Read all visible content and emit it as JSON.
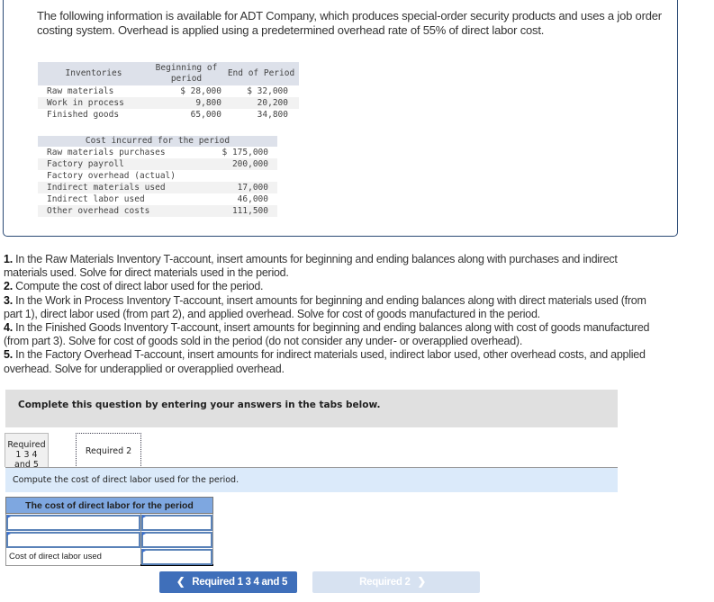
{
  "intro": "The following information is available for ADT Company, which produces special-order security products and uses a job order costing system. Overhead is applied using a predetermined overhead rate of 55% of direct labor cost.",
  "inventories": {
    "headers": [
      "Inventories",
      "Beginning of period",
      "End of Period"
    ],
    "rows": [
      {
        "label": "Raw materials",
        "beginning": "$ 28,000",
        "end": "$ 32,000"
      },
      {
        "label": "Work in process",
        "beginning": "9,800",
        "end": "20,200"
      },
      {
        "label": "Finished goods",
        "beginning": "65,000",
        "end": "34,800"
      }
    ]
  },
  "costs": {
    "header": "Cost incurred for the period",
    "rows": [
      {
        "label": "Raw materials purchases",
        "value": "$ 175,000"
      },
      {
        "label": "Factory payroll",
        "value": "200,000"
      },
      {
        "label": "Factory overhead (actual)",
        "value": ""
      },
      {
        "label": "Indirect materials used",
        "value": "17,000"
      },
      {
        "label": "Indirect labor used",
        "value": "46,000"
      },
      {
        "label": "Other overhead costs",
        "value": "111,500"
      }
    ]
  },
  "requirements": [
    {
      "num": "1.",
      "text": " In the Raw Materials Inventory T-account, insert amounts for beginning and ending balances along with purchases and indirect materials used. Solve for direct materials used in the period."
    },
    {
      "num": "2.",
      "text": " Compute the cost of direct labor used for the period."
    },
    {
      "num": "3.",
      "text": " In the Work in Process Inventory T-account, insert amounts for beginning and ending balances along with direct materials used (from part 1), direct labor used (from part 2), and applied overhead. Solve for cost of goods manufactured in the period."
    },
    {
      "num": "4.",
      "text": " In the Finished Goods Inventory T-account, insert amounts for beginning and ending balances along with cost of goods manufactured (from part 3). Solve for cost of goods sold in the period (do not consider any under- or overapplied overhead)."
    },
    {
      "num": "5.",
      "text": " In the Factory Overhead T-account, insert amounts for indirect materials used, indirect labor used, other overhead costs, and applied overhead. Solve for underapplied or overapplied overhead."
    }
  ],
  "complete_prompt": "Complete this question by entering your answers in the tabs below.",
  "tabs": [
    {
      "label_line1": "Required 1 3 4",
      "label_line2": "and 5",
      "active": false
    },
    {
      "label": "Required 2",
      "active": true
    }
  ],
  "instruction": "Compute the cost of direct labor used for the period.",
  "answer_table": {
    "header": "The cost of direct labor for the period",
    "rows": [
      {
        "label_value": "",
        "amount_value": ""
      },
      {
        "label_value": "",
        "amount_value": ""
      }
    ],
    "total_label": "Cost of direct labor used",
    "total_value": ""
  },
  "nav": {
    "prev_label": "Required 1 3 4 and 5",
    "next_label": "Required 2",
    "prev_icon": "chevron-left-icon",
    "next_icon": "chevron-right-icon"
  },
  "colors": {
    "tab_header": "#7ea7e0",
    "nav_active": "#3f6fba",
    "nav_disabled": "#d7e2f1",
    "instruction_bg": "#dbeafa"
  }
}
